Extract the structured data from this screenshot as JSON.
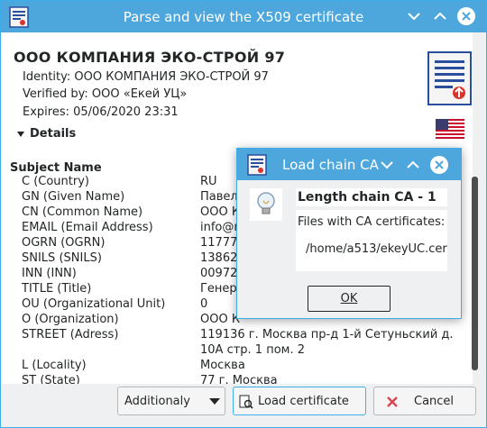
{
  "window": {
    "title": "Parse and view the X509 certificate",
    "icon": "certificate-icon",
    "controls": [
      "chevron-down-icon",
      "chevron-up-icon",
      "close-icon"
    ]
  },
  "header": {
    "cert_title": "ООО КОМПАНИЯ ЭКО-СТРОЙ 97",
    "identity": "Identity: ООО КОМПАНИЯ ЭКО-СТРОЙ 97",
    "verified": "Verified by: ООО «Екей УЦ»",
    "expires": "Expires: 05/06/2020 23:31",
    "doc_icon": "certificate-document-icon",
    "flag_icon": "us-flag-icon"
  },
  "details_label": "Details",
  "subject": {
    "heading": "Subject Name",
    "rows": [
      {
        "label": "C (Country)",
        "value": "RU"
      },
      {
        "label": "GN (Given Name)",
        "value": "Павел"
      },
      {
        "label": "CN (Common Name)",
        "value": "ООО К"
      },
      {
        "label": "EMAIL (Email Address)",
        "value": "info@r"
      },
      {
        "label": "OGRN (OGRN)",
        "value": "11777"
      },
      {
        "label": "SNILS (SNILS)",
        "value": "13862"
      },
      {
        "label": "INN (INN)",
        "value": "00972"
      },
      {
        "label": "TITLE (Title)",
        "value": "Генер"
      },
      {
        "label": "OU (Organizational Unit)",
        "value": "0"
      },
      {
        "label": "O (Organization)",
        "value": "ООО К"
      },
      {
        "label": "STREET (Adress)",
        "value": "119136 г. Москва пр-д 1-й Сетуньский д."
      },
      {
        "label": "",
        "value": "10А стр. 1 пом. 2"
      },
      {
        "label": "L (Locality)",
        "value": "Москва"
      },
      {
        "label": "ST (State)",
        "value": "77 г. Москва"
      }
    ]
  },
  "buttons": {
    "additionaly": "Additionaly",
    "load_certificate": "Load certificate",
    "cancel": "Cancel"
  },
  "popup": {
    "title": "Load chain CA",
    "heading": "Length chain CA - 1",
    "files_label": "Files with CA certificates:",
    "file_path": "/home/a513/ekeyUC.cer",
    "ok_label": "OK"
  }
}
